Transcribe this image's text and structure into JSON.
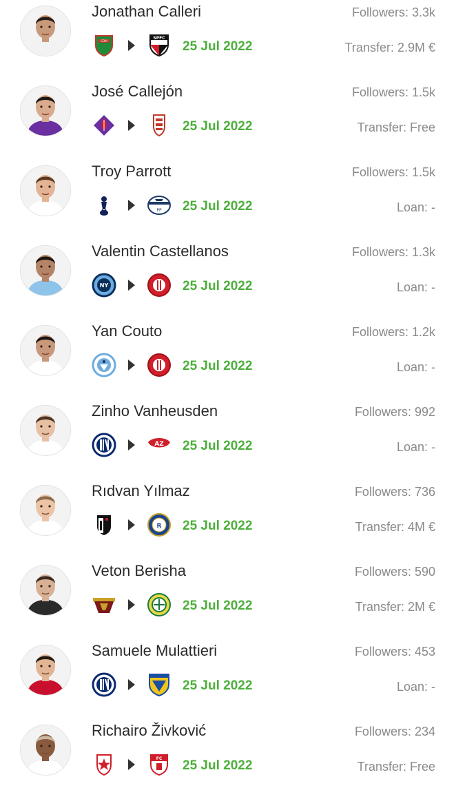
{
  "transfers": [
    {
      "name": "Jonathan Calleri",
      "followers": "Followers: 3.3k",
      "from_club_icon": "maldonado-crest-icon",
      "to_club_icon": "sao-paulo-crest-icon",
      "date": "25 Jul 2022",
      "fee": "Transfer: 2.9M €",
      "skin": "#c99a7a",
      "hair": "#2a1d17",
      "shirt": "#f2f2f2"
    },
    {
      "name": "José Callejón",
      "followers": "Followers: 1.5k",
      "from_club_icon": "fiorentina-crest-icon",
      "to_club_icon": "granada-crest-icon",
      "date": "25 Jul 2022",
      "fee": "Transfer: Free",
      "skin": "#d9ab8c",
      "hair": "#1f1712",
      "shirt": "#6a2fa0"
    },
    {
      "name": "Troy Parrott",
      "followers": "Followers: 1.5k",
      "from_club_icon": "tottenham-crest-icon",
      "to_club_icon": "preston-crest-icon",
      "date": "25 Jul 2022",
      "fee": "Loan: -",
      "skin": "#e3b393",
      "hair": "#5a3a22",
      "shirt": "#ffffff"
    },
    {
      "name": "Valentin Castellanos",
      "followers": "Followers: 1.3k",
      "from_club_icon": "nycfc-crest-icon",
      "to_club_icon": "girona-crest-icon",
      "date": "25 Jul 2022",
      "fee": "Loan: -",
      "skin": "#b58466",
      "hair": "#1b1410",
      "shirt": "#8ec4ea"
    },
    {
      "name": "Yan Couto",
      "followers": "Followers: 1.2k",
      "from_club_icon": "man-city-crest-icon",
      "to_club_icon": "girona-crest-icon",
      "date": "25 Jul 2022",
      "fee": "Loan: -",
      "skin": "#c9977a",
      "hair": "#1d1512",
      "shirt": "#ffffff"
    },
    {
      "name": "Zinho Vanheusden",
      "followers": "Followers: 992",
      "from_club_icon": "inter-crest-icon",
      "to_club_icon": "az-alkmaar-crest-icon",
      "date": "25 Jul 2022",
      "fee": "Loan: -",
      "skin": "#e7bfa3",
      "hair": "#4a3325",
      "shirt": "#ffffff"
    },
    {
      "name": "Rıdvan Yılmaz",
      "followers": "Followers: 736",
      "from_club_icon": "besiktas-crest-icon",
      "to_club_icon": "rangers-crest-icon",
      "date": "25 Jul 2022",
      "fee": "Transfer: 4M €",
      "skin": "#ecc3a5",
      "hair": "#8a6a48",
      "shirt": "#ffffff"
    },
    {
      "name": "Veton Berisha",
      "followers": "Followers: 590",
      "from_club_icon": "venezia-crest-icon",
      "to_club_icon": "hammarby-crest-icon",
      "date": "25 Jul 2022",
      "fee": "Transfer: 2M €",
      "skin": "#d8b093",
      "hair": "#3a2a20",
      "shirt": "#2a2a2a"
    },
    {
      "name": "Samuele Mulattieri",
      "followers": "Followers: 453",
      "from_club_icon": "inter-crest-icon",
      "to_club_icon": "frosinone-crest-icon",
      "date": "25 Jul 2022",
      "fee": "Loan: -",
      "skin": "#e2b595",
      "hair": "#241812",
      "shirt": "#c8102e"
    },
    {
      "name": "Richairo Živković",
      "followers": "Followers: 234",
      "from_club_icon": "red-star-crest-icon",
      "to_club_icon": "fc-emmen-crest-icon",
      "date": "25 Jul 2022",
      "fee": "Transfer: Free",
      "skin": "#8a5a3e",
      "hair": "#c9b8a0",
      "shirt": "#ffffff"
    }
  ]
}
